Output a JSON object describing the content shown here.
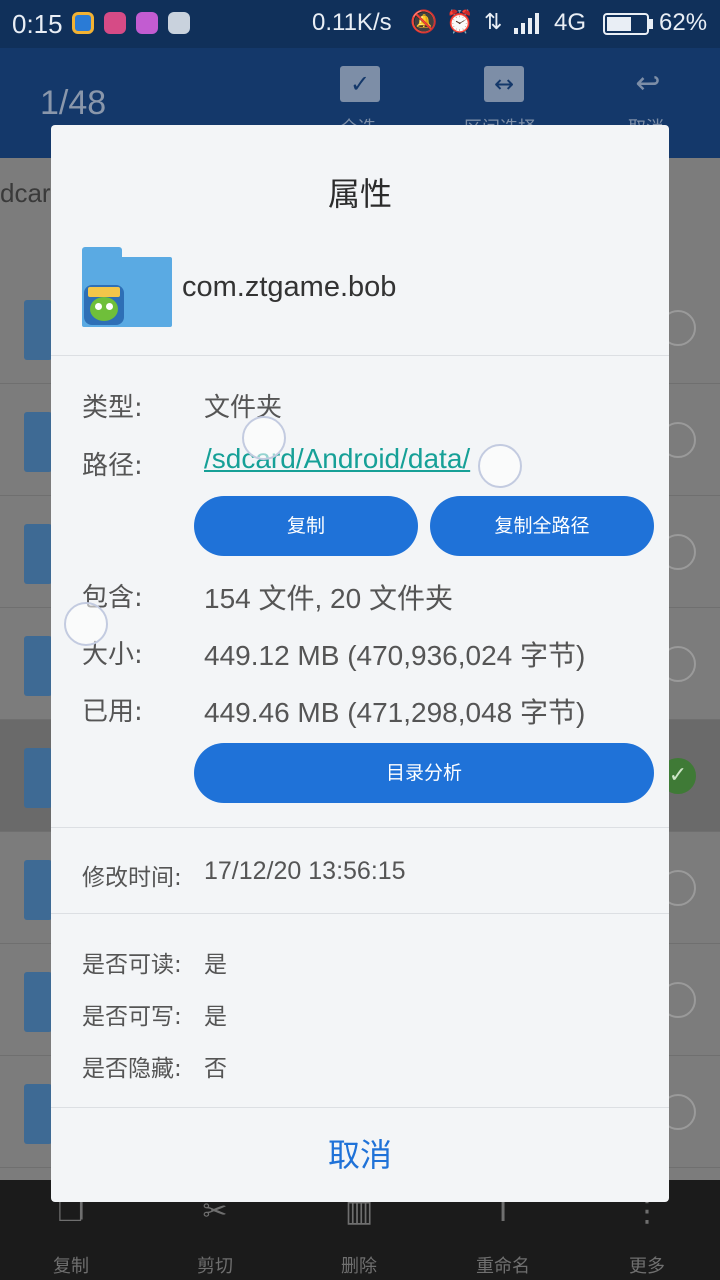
{
  "status_bar": {
    "time": "0:15",
    "speed": "0.11K/s",
    "network": "4G",
    "battery_level": 62,
    "battery_text": "62%",
    "icons": [
      "app-notification-icon",
      "app-notification-icon",
      "app-notification-icon",
      "app-notification-icon",
      "mute-icon",
      "alarm-icon",
      "data-transfer-icon",
      "signal-icon",
      "battery-icon"
    ]
  },
  "toolbar": {
    "counter": "1/48",
    "select_all_label": "全选",
    "range_select_label": "区间选择",
    "cancel_label": "取消"
  },
  "background_list": {
    "breadcrumb": "dcard"
  },
  "bottom_bar": {
    "copy": "复制",
    "cut": "剪切",
    "delete": "删除",
    "rename": "重命名",
    "more": "更多"
  },
  "dialog": {
    "title": "属性",
    "folder_name": "com.ztgame.bob",
    "type_label": "类型:",
    "type_value": "文件夹",
    "path_label": "路径:",
    "path_value": "/sdcard/Android/data/",
    "copy_button": "复制",
    "copy_full_path_button": "复制全路径",
    "contains_label": "包含:",
    "contains_value": "154 文件, 20 文件夹",
    "size_label": "大小:",
    "size_value": "449.12 MB (470,936,024 字节)",
    "used_label": "已用:",
    "used_value": "449.46 MB (471,298,048 字节)",
    "dir_analysis_button": "目录分析",
    "modified_label": "修改时间:",
    "modified_value": "17/12/20 13:56:15",
    "readable_label": "是否可读:",
    "readable_value": "是",
    "writable_label": "是否可写:",
    "writable_value": "是",
    "hidden_label": "是否隐藏:",
    "hidden_value": "否",
    "cancel_button": "取消"
  },
  "colors": {
    "accent": "#1f72d8",
    "path_link": "#16a097",
    "status_bar": "#10305a",
    "folder": "#5aaae3"
  }
}
